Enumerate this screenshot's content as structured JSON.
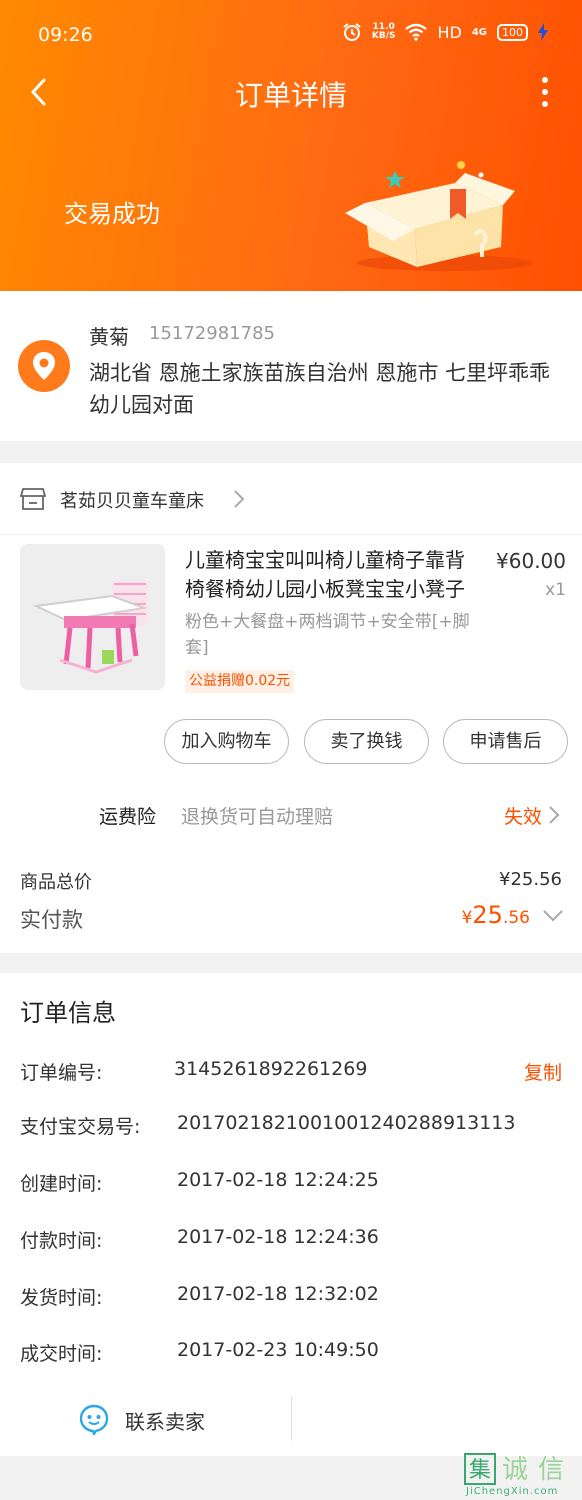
{
  "status_bar": {
    "time": "09:26",
    "speed_value": "11.0",
    "speed_unit": "KB/S",
    "hd": "HD",
    "network": "4G",
    "battery": "100"
  },
  "nav": {
    "title": "订单详情",
    "back_icon": "chevron-left-icon",
    "more_icon": "more-vertical-icon"
  },
  "header": {
    "status": "交易成功"
  },
  "address": {
    "name": "黄菊",
    "phone": "15172981785",
    "detail": "湖北省 恩施土家族苗族自治州 恩施市 七里坪乖乖幼儿园对面",
    "icon": "location-pin-icon"
  },
  "shop": {
    "name": "茗茹贝贝童车童床",
    "icon": "store-icon"
  },
  "product": {
    "title": "儿童椅宝宝叫叫椅儿童椅子靠背椅餐椅幼儿园小板凳宝宝小凳子",
    "price": "¥60.00",
    "quantity": "x1",
    "spec": "粉色+大餐盘+两档调节+安全带[+脚套]",
    "charity": "公益捐赠0.02元"
  },
  "actions": {
    "add_to_cart": "加入购物车",
    "resell": "卖了换钱",
    "after_sale": "申请售后"
  },
  "insurance": {
    "label": "运费险",
    "desc": "退换货可自动理赔",
    "status": "失效"
  },
  "totals": {
    "goods_total_label": "商品总价",
    "goods_total_value": "¥25.56",
    "paid_label": "实付款",
    "paid_currency": "¥",
    "paid_integer": "25",
    "paid_decimal": ".56"
  },
  "order_info": {
    "heading": "订单信息",
    "copy_label": "复制",
    "rows": [
      {
        "label": "订单编号:",
        "value": "3145261892261269"
      },
      {
        "label": "支付宝交易号:",
        "value": "2017021821001001240288913113"
      },
      {
        "label": "创建时间:",
        "value": "2017-02-18 12:24:25"
      },
      {
        "label": "付款时间:",
        "value": "2017-02-18 12:24:36"
      },
      {
        "label": "发货时间:",
        "value": "2017-02-18 12:32:02"
      },
      {
        "label": "成交时间:",
        "value": "2017-02-23 10:49:50"
      }
    ],
    "contact_label": "联系卖家",
    "contact_icon": "chat-bubble-icon"
  },
  "watermark": {
    "brand": "集诚信",
    "domain": "JiChengXin.com"
  },
  "colors": {
    "accent": "#ff5000",
    "header_start": "#ff8a00",
    "header_end": "#ff5000"
  }
}
